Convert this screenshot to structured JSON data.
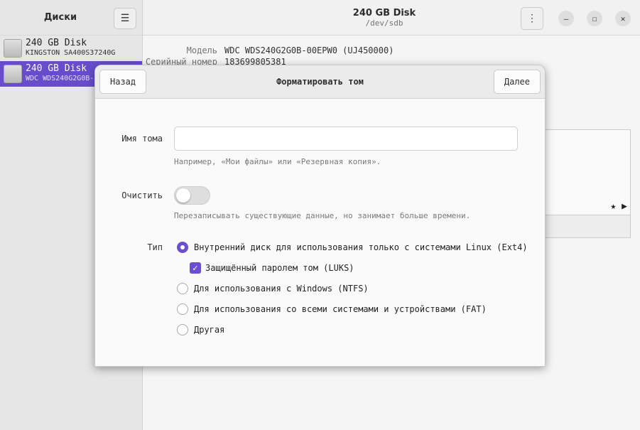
{
  "sidebar": {
    "title": "Диски",
    "items": [
      {
        "name": "240 GB Disk",
        "model": "KINGSTON SA400S37240G"
      },
      {
        "name": "240 GB Disk",
        "model": "WDC WDS240G2G0B-"
      }
    ]
  },
  "main": {
    "title": "240 GB Disk",
    "subtitle": "/dev/sdb",
    "info": [
      {
        "label": "Модель",
        "value": "WDC WDS240G2G0B-00EPW0 (UJ450000)"
      },
      {
        "label": "Серийный номер",
        "value": "183699805381"
      }
    ]
  },
  "icons": {
    "menu": "hamburger-icon",
    "kebab": "kebab-menu-icon",
    "minimize": "minimize-icon",
    "maximize": "maximize-icon",
    "close": "close-icon"
  },
  "dialog": {
    "title": "Форматировать том",
    "back_label": "Назад",
    "next_label": "Далее",
    "name_label": "Имя тома",
    "name_value": "",
    "name_hint": "Например, «Мои файлы» или «Резервная копия».",
    "erase_label": "Очистить",
    "erase_enabled": false,
    "erase_hint": "Перезаписывать существующие данные, но занимает больше времени.",
    "type_label": "Тип",
    "options": [
      {
        "label": "Внутренний диск для использования только с системами Linux (Ext4)",
        "selected": true
      },
      {
        "label": "Для использования с Windows (NTFS)",
        "selected": false
      },
      {
        "label": "Для использования со всеми системами и устройствами (FAT)",
        "selected": false
      },
      {
        "label": "Другая",
        "selected": false
      }
    ],
    "luks_label": "Защищённый паролем том (LUKS)",
    "luks_checked": true
  },
  "colors": {
    "accent": "#6a4fd1"
  }
}
